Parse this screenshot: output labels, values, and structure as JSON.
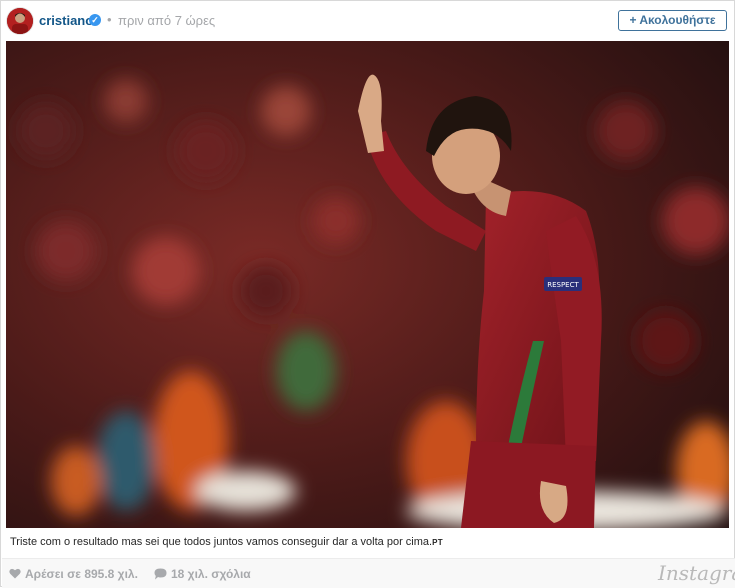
{
  "header": {
    "username": "cristiano",
    "verified_icon": "verified-badge-icon",
    "separator": "•",
    "time": "πριν από 7 ώρες",
    "follow_label": "+ Ακολουθήστε"
  },
  "photo": {
    "jersey_text": "RESPECT"
  },
  "caption": {
    "text": "Triste com o resultado mas sei que todos juntos vamos conseguir dar a volta por cima.",
    "tag": "PT"
  },
  "footer": {
    "likes": "Αρέσει σε 895.8 χιλ.",
    "comments": "18 χιλ. σχόλια",
    "brand": "Instagram"
  },
  "colors": {
    "link": "#125688",
    "follow": "#3f729b",
    "verified": "#3897f0",
    "muted": "#a7a9ac"
  }
}
